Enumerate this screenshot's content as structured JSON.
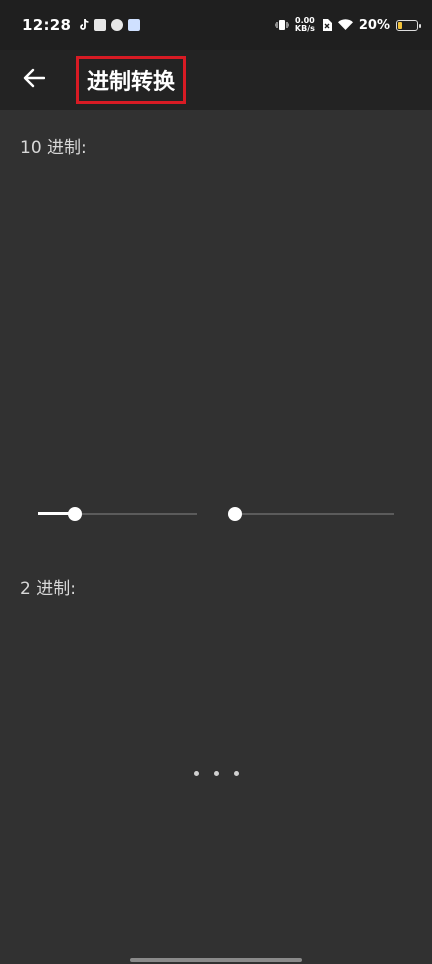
{
  "status_bar": {
    "time": "12:28",
    "net_speed_value": "0.00",
    "net_speed_unit": "KB/s",
    "battery_percent": "20%",
    "battery_level": 0.2
  },
  "app_bar": {
    "title": "进制转换",
    "back_icon": "arrow-left-icon"
  },
  "main": {
    "decimal_label": "10 进制:",
    "binary_label": "2 进制:",
    "sliders": [
      {
        "value": 0.23
      },
      {
        "value": 0.0
      }
    ]
  },
  "colors": {
    "background": "#313131",
    "app_bar": "#232323",
    "highlight_border": "#d81b24",
    "battery": "#f2c23a"
  }
}
